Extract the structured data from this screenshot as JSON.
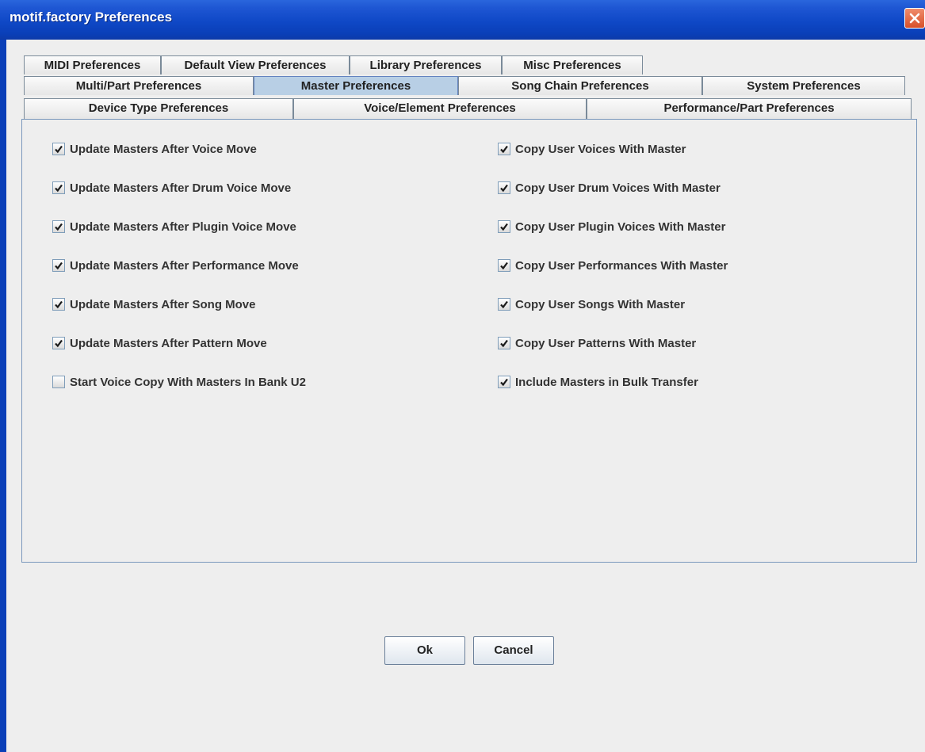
{
  "window": {
    "title": "motif.factory Preferences"
  },
  "tabs": {
    "row1": [
      {
        "label": "MIDI Preferences"
      },
      {
        "label": "Default View Preferences"
      },
      {
        "label": "Library Preferences"
      },
      {
        "label": "Misc Preferences"
      }
    ],
    "row2": [
      {
        "label": "Multi/Part Preferences"
      },
      {
        "label": "Master Preferences",
        "selected": true
      },
      {
        "label": "Song Chain Preferences"
      },
      {
        "label": "System Preferences"
      }
    ],
    "row3": [
      {
        "label": "Device Type Preferences"
      },
      {
        "label": "Voice/Element Preferences"
      },
      {
        "label": "Performance/Part Preferences"
      }
    ]
  },
  "options": {
    "left": [
      {
        "label": "Update Masters After Voice Move",
        "checked": true
      },
      {
        "label": "Update Masters After Drum Voice Move",
        "checked": true
      },
      {
        "label": "Update Masters After Plugin Voice Move",
        "checked": true
      },
      {
        "label": "Update Masters After Performance Move",
        "checked": true
      },
      {
        "label": "Update Masters After Song Move",
        "checked": true
      },
      {
        "label": "Update Masters After Pattern Move",
        "checked": true
      },
      {
        "label": "Start Voice Copy With Masters In Bank U2",
        "checked": false
      }
    ],
    "right": [
      {
        "label": "Copy User Voices With Master",
        "checked": true
      },
      {
        "label": "Copy User Drum Voices With Master",
        "checked": true
      },
      {
        "label": "Copy User Plugin Voices With Master",
        "checked": true
      },
      {
        "label": "Copy User Performances With Master",
        "checked": true
      },
      {
        "label": "Copy User Songs With Master",
        "checked": true
      },
      {
        "label": "Copy User Patterns With Master",
        "checked": true
      },
      {
        "label": "Include Masters in Bulk Transfer",
        "checked": true
      }
    ]
  },
  "buttons": {
    "ok": "Ok",
    "cancel": "Cancel"
  },
  "icons": {
    "close": "close-icon",
    "check": "check-mark-icon"
  },
  "colors": {
    "titlebar": "#0a3fb8",
    "selected_tab": "#b8cfe5",
    "panel_border": "#7a98bc"
  }
}
